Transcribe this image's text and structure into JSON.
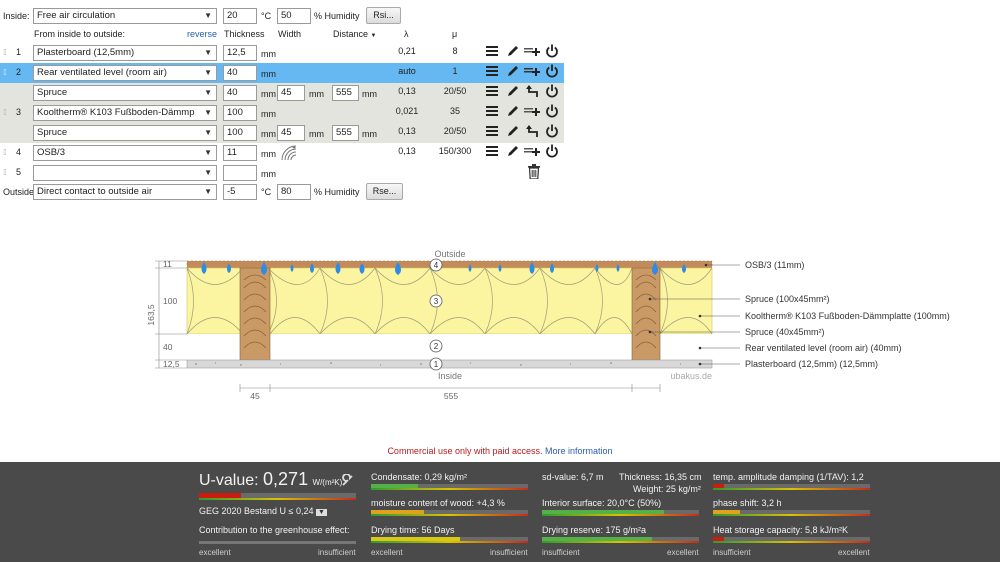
{
  "inside": {
    "label": "Inside:",
    "climate": "Free air circulation",
    "temp": "20",
    "temp_unit": "°C",
    "humidity": "50",
    "humidity_unit": "% Humidity",
    "rsi_button": "Rsi..."
  },
  "header": {
    "from_inside": "From inside to outside:",
    "reverse": "reverse",
    "thickness": "Thickness",
    "width": "Width",
    "distance": "Distance",
    "lambda": "λ",
    "mu": "μ"
  },
  "layers": [
    {
      "num": "1",
      "material": "Plasterboard (12,5mm)",
      "thickness": "12,5",
      "unit": "mm",
      "lambda": "0,21",
      "mu": "8"
    },
    {
      "num": "2",
      "material": "Rear ventilated level (room air)",
      "thickness": "40",
      "unit": "mm",
      "lambda": "auto",
      "mu": "1"
    },
    {
      "num": "",
      "material": "Spruce",
      "thickness": "40",
      "unit": "mm",
      "width": "45",
      "width_unit": "mm",
      "distance": "555",
      "distance_unit": "mm",
      "lambda": "0,13",
      "mu": "20/50"
    },
    {
      "num": "3",
      "material": "Kooltherm® K103 Fußboden-Dämmp",
      "thickness": "100",
      "unit": "mm",
      "lambda": "0,021",
      "mu": "35"
    },
    {
      "num": "",
      "material": "Spruce",
      "thickness": "100",
      "unit": "mm",
      "width": "45",
      "width_unit": "mm",
      "distance": "555",
      "distance_unit": "mm",
      "lambda": "0,13",
      "mu": "20/50"
    },
    {
      "num": "4",
      "material": "OSB/3",
      "thickness": "11",
      "unit": "mm",
      "lambda": "0,13",
      "mu": "150/300"
    },
    {
      "num": "5",
      "material": "",
      "thickness": "",
      "unit": "mm",
      "lambda": "",
      "mu": ""
    }
  ],
  "outside": {
    "label": "Outside",
    "climate": "Direct contact to outside air",
    "temp": "-5",
    "temp_unit": "°C",
    "humidity": "80",
    "humidity_unit": "% Humidity",
    "rse_button": "Rse..."
  },
  "diagram": {
    "outside": "Outside",
    "inside": "Inside",
    "watermark": "ubakus.de",
    "dim_total": "163,5",
    "dims": [
      "11",
      "100",
      "40",
      "12,5"
    ],
    "bottom_dims": [
      "45",
      "555"
    ],
    "circles": [
      "4",
      "3",
      "2",
      "1"
    ],
    "legend": [
      "OSB/3 (11mm)",
      "Spruce (100x45mm²)",
      "Kooltherm® K103 Fußboden-Dämmplatte (100mm)",
      "Spruce (40x45mm²)",
      "Rear ventilated level (room air) (40mm)",
      "Plasterboard (12,5mm) (12,5mm)"
    ],
    "colors": {
      "insulation": "#fbf4a0",
      "wood": "#c99a66",
      "osb": "#c38b5a",
      "plaster": "#d8d8d8",
      "drop": "#2d8ce6"
    }
  },
  "notice": {
    "text": "Commercial use only with paid access.",
    "link": "More information"
  },
  "results": {
    "u_label": "U-value:",
    "u_value": "0,271",
    "u_unit": "W/(m²K)",
    "u_level": 0.25,
    "geg": "GEG 2020 Bestand U ≤ 0,24",
    "greenhouse": "Contribution to the greenhouse effect:",
    "excellent": "excellent",
    "insufficient": "insufficient",
    "condensate": "Condensate: 0,29 kg/m²",
    "moisture": "moisture content of wood: +4,3 %",
    "drying_time": "Drying time: 56 Days",
    "sd": "sd-value: 6,7 m",
    "thickness": "Thickness: 16,35 cm",
    "weight": "Weight: 25 kg/m²",
    "interior": "Interior surface: 20,0°C (50%)",
    "drying_reserve": "Drying reserve: 175 g/m²a",
    "temp_damping": "temp. amplitude damping (1/TAV): 1,2",
    "phase_shift": "phase shift: 3,2 h",
    "heat_storage": "Heat storage capacity: 5,8 kJ/m²K",
    "colors": {
      "red": "#cc1b10",
      "orange": "#e0a020",
      "green": "#55b04a",
      "yellow": "#d8c818"
    }
  }
}
